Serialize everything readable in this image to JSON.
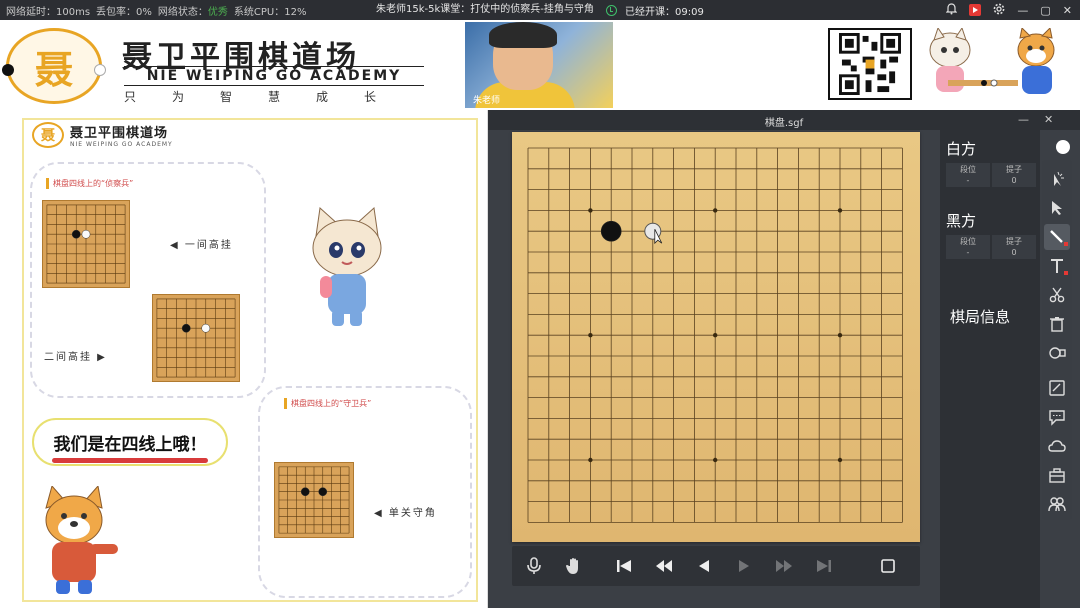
{
  "status_bar": {
    "latency_label": "网络延时：100ms",
    "loss_label": "丢包率：0%",
    "net_label": "网络状态：",
    "net_value": "优秀",
    "cpu_label": "系统CPU：12%",
    "class_title": "朱老师15k-5k课堂：打仗中的侦察兵-挂角与守角",
    "elapsed": "已经开课：09:09"
  },
  "header": {
    "logo_char": "聂",
    "brand_cn": "聂卫平围棋道场",
    "brand_en": "NIE WEIPING GO ACADEMY",
    "slogan": "只为智慧成长",
    "video_label": "朱老师"
  },
  "slide": {
    "brand_cn": "聂卫平围棋道场",
    "brand_en": "NIE WEIPING GO ACADEMY",
    "logo_char": "聂",
    "section1_title": "棋盘四线上的“侦察兵”",
    "caption_one_space": "◀  一间高挂",
    "caption_two_space": "二间高挂  ▶",
    "section2_title": "棋盘四线上的“守卫兵”",
    "caption_single": "◀  单关守角",
    "callout": "我们是在四线上哦！"
  },
  "board_window": {
    "title": "棋盘.sgf",
    "minimize": "—",
    "close": "✕"
  },
  "side_panel": {
    "white_name": "白方",
    "black_name": "黑方",
    "rank_label": "段位",
    "rank_value": "-",
    "captures_label": "提子",
    "white_captures": "0",
    "black_captures": "0",
    "game_info": "棋局信息"
  },
  "icons": {
    "microphone": "microphone-icon",
    "hand": "hand-icon",
    "first": "skip-first-icon",
    "fast_back": "fast-back-icon",
    "back": "step-back-icon",
    "forward": "step-forward-icon",
    "fast_forward": "fast-forward-icon",
    "last": "skip-last-icon",
    "stop": "stop-square-icon"
  },
  "colors": {
    "status_good": "#4caf50",
    "board_wood": "#e3bd78",
    "brand_gold": "#e8a524",
    "accent_red": "#d83b3b"
  },
  "board": {
    "size": 19,
    "stones": [
      {
        "x": 4,
        "y": 4,
        "color": "black"
      }
    ],
    "hover": {
      "x": 6,
      "y": 4
    }
  }
}
